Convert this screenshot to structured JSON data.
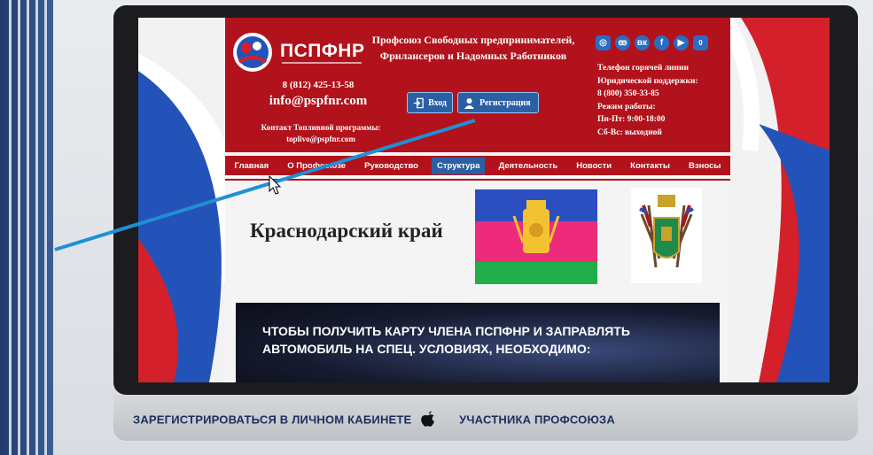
{
  "org_name": "Профсоюз Свободных предпринимателей, Фрилансеров и Надомных Работников",
  "logo": "ПСПФНР",
  "phone": "8 (812) 425-13-58",
  "email": "info@pspfnr.com",
  "fuel_contact": "Контакт Топливной программы: toplivo@pspfnr.com",
  "login_label": "Вход",
  "register_label": "Регистрация",
  "hotline": {
    "l1": "Телефон горячей линии",
    "l2": "Юридической поддержки:",
    "l3": "8 (800) 350-33-85",
    "l4": "Режим работы:",
    "l5": "Пн-Пт: 9:00-18:00",
    "l6": "Сб-Вс: выходной"
  },
  "cart_count": "0",
  "nav": [
    "Главная",
    "О Профсоюзе",
    "Руководство",
    "Структура",
    "Деятельность",
    "Новости",
    "Контакты",
    "Взносы"
  ],
  "active_nav": "Структура",
  "region_title": "Краснодарский край",
  "banner_line1": "ЧТОБЫ ПОЛУЧИТЬ КАРТУ ЧЛЕНА ПСПФНР  И  ЗАПРАВЛЯТЬ",
  "banner_line2": "АВТОМОБИЛЬ НА СПЕЦ. УСЛОВИЯХ, НЕОБХОДИМО:",
  "caption_left": "ЗАРЕГИСТРИРОВАТЬСЯ В ЛИЧНОМ КАБИНЕТЕ",
  "caption_right": "УЧАСТНИКА  ПРОФСОЮЗА",
  "colors": {
    "header_red": "#b2121b",
    "button_blue": "#2b5fa4",
    "arrow_blue": "#1f8fd6",
    "caption_blue": "#1c2e5e"
  },
  "icons": [
    "instagram-icon",
    "odnoklassniki-icon",
    "vk-icon",
    "facebook-icon",
    "youtube-icon",
    "cart-icon",
    "apple-icon",
    "login-icon",
    "user-icon",
    "cursor-icon"
  ]
}
